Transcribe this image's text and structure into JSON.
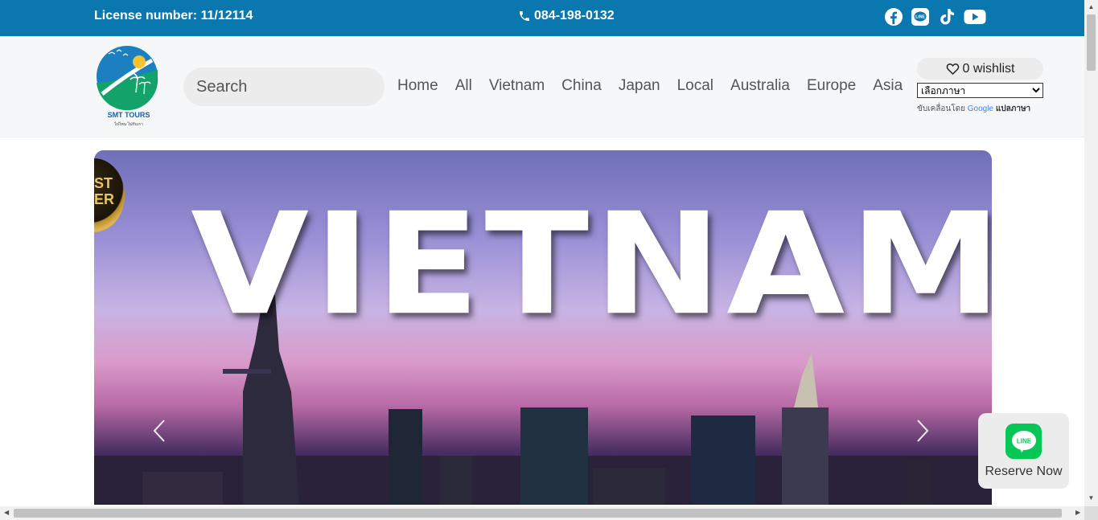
{
  "topbar": {
    "license": "License number: 11/12114",
    "phone": "084-198-0132",
    "socials": [
      "facebook-icon",
      "line-icon",
      "tiktok-icon",
      "youtube-icon"
    ]
  },
  "header": {
    "logo_text": "SMT TOURS",
    "logo_tagline": "ไปไหน ไปกับเรา",
    "search_placeholder": "Search",
    "nav": [
      "Home",
      "All",
      "Vietnam",
      "China",
      "Japan",
      "Local",
      "Australia",
      "Europe",
      "Asia"
    ],
    "wishlist_label": "0 wishlist",
    "language_select": "เลือกภาษา",
    "powered_prefix": "ขับเคลื่อนโดย",
    "powered_google": "Google",
    "powered_suffix": "แปลภาษา"
  },
  "hero": {
    "title": "VIETNAM",
    "badge_text": "ST\nER",
    "prev_label": "‹",
    "next_label": "›"
  },
  "reserve": {
    "icon_text": "LINE",
    "label": "Reserve Now"
  },
  "colors": {
    "topbar": "#0a78ae",
    "header_bg": "#f6f7f9",
    "line_green": "#06c755"
  }
}
